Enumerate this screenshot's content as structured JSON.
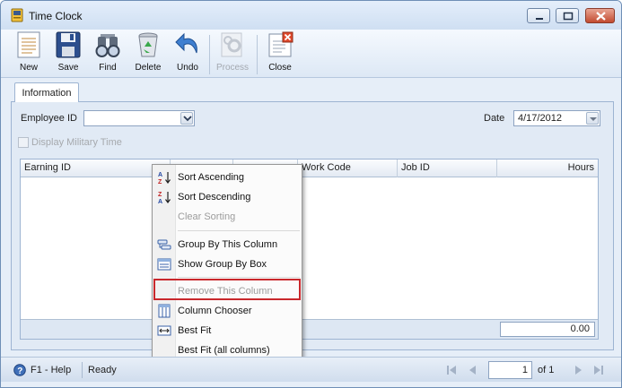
{
  "window": {
    "title": "Time Clock"
  },
  "toolbar": {
    "new": "New",
    "save": "Save",
    "find": "Find",
    "delete": "Delete",
    "undo": "Undo",
    "process": "Process",
    "close": "Close"
  },
  "tabs": [
    "Information"
  ],
  "form": {
    "employee_label": "Employee ID",
    "employee_value": "",
    "date_label": "Date",
    "date_value": "4/17/2012",
    "military_label": "Display Military Time"
  },
  "grid": {
    "columns": [
      "Earning ID",
      "",
      "",
      "Work Code",
      "Job ID",
      "Hours"
    ],
    "total": "0.00"
  },
  "context_menu": {
    "items": [
      {
        "label": "Sort Ascending",
        "icon": "sort-ascending-icon",
        "enabled": true
      },
      {
        "label": "Sort Descending",
        "icon": "sort-descending-icon",
        "enabled": true
      },
      {
        "label": "Clear Sorting",
        "icon": "",
        "enabled": false
      },
      {
        "label": "Group By This Column",
        "icon": "group-by-column-icon",
        "enabled": true
      },
      {
        "label": "Show Group By Box",
        "icon": "group-by-box-icon",
        "enabled": true
      },
      {
        "label": "Remove This Column",
        "icon": "",
        "enabled": false
      },
      {
        "label": "Column Chooser",
        "icon": "column-chooser-icon",
        "enabled": true
      },
      {
        "label": "Best Fit",
        "icon": "best-fit-icon",
        "enabled": true
      },
      {
        "label": "Best Fit (all columns)",
        "icon": "",
        "enabled": true
      }
    ],
    "highlighted_item": "Remove This Column",
    "highlight_color": "#c9282c"
  },
  "status": {
    "help": "F1 - Help",
    "state": "Ready",
    "page": "1",
    "of_label": "of 1"
  }
}
